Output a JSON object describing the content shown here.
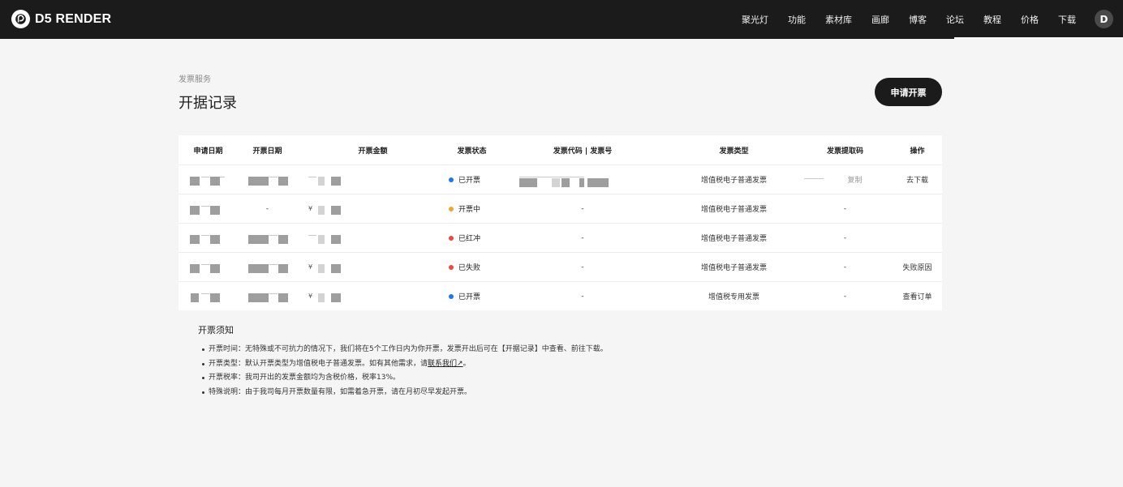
{
  "brand": {
    "logo_text": "D5 RENDER"
  },
  "nav": {
    "items": [
      "聚光灯",
      "功能",
      "素材库",
      "画廊",
      "博客",
      "论坛",
      "教程",
      "价格",
      "下载"
    ],
    "avatar_letter": "D"
  },
  "header": {
    "breadcrumb": "发票服务",
    "title": "开据记录",
    "apply_button": "申请开票"
  },
  "table": {
    "columns": [
      "申请日期",
      "开票日期",
      "开票金额",
      "发票状态",
      "发票代码 | 发票号",
      "发票类型",
      "发票提取码",
      "操作"
    ],
    "rows": [
      {
        "apply_date": "",
        "issue_date": "",
        "amount_prefix": "",
        "status": "已开票",
        "status_color": "#1677ff",
        "code": "",
        "type": "增值税电子普通发票",
        "extract": "复制",
        "action": "去下载"
      },
      {
        "apply_date": "",
        "issue_date": "-",
        "amount_prefix": "¥",
        "status": "开票中",
        "status_color": "#f5a623",
        "code": "-",
        "type": "增值税电子普通发票",
        "extract": "-",
        "action": ""
      },
      {
        "apply_date": "",
        "issue_date": "",
        "amount_prefix": "",
        "status": "已红冲",
        "status_color": "#f0463c",
        "code": "-",
        "type": "增值税电子普通发票",
        "extract": "-",
        "action": ""
      },
      {
        "apply_date": "",
        "issue_date": "",
        "amount_prefix": "¥",
        "status": "已失败",
        "status_color": "#f0463c",
        "code": "-",
        "type": "增值税电子普通发票",
        "extract": "-",
        "action": "失败原因"
      },
      {
        "apply_date": "",
        "issue_date": "",
        "amount_prefix": "¥",
        "status": "已开票",
        "status_color": "#1677ff",
        "code": "-",
        "type": "增值税专用发票",
        "extract": "-",
        "action": "查看订单"
      }
    ]
  },
  "notes": {
    "title": "开票须知",
    "items": [
      {
        "text": "开票时间：无特殊或不可抗力的情况下，我们将在5个工作日内为你开票，发票开出后可在【开据记录】中查看、前往下载。"
      },
      {
        "text": "开票类型：默认开票类型为增值税电子普通发票。如有其他需求，请",
        "link": "联系我们↗",
        "suffix": "。"
      },
      {
        "text": "开票税率：我司开出的发票金额均为含税价格，税率13%。"
      },
      {
        "text": "特殊说明：由于我司每月开票数量有限，如需着急开票，请在月初尽早发起开票。"
      }
    ]
  }
}
